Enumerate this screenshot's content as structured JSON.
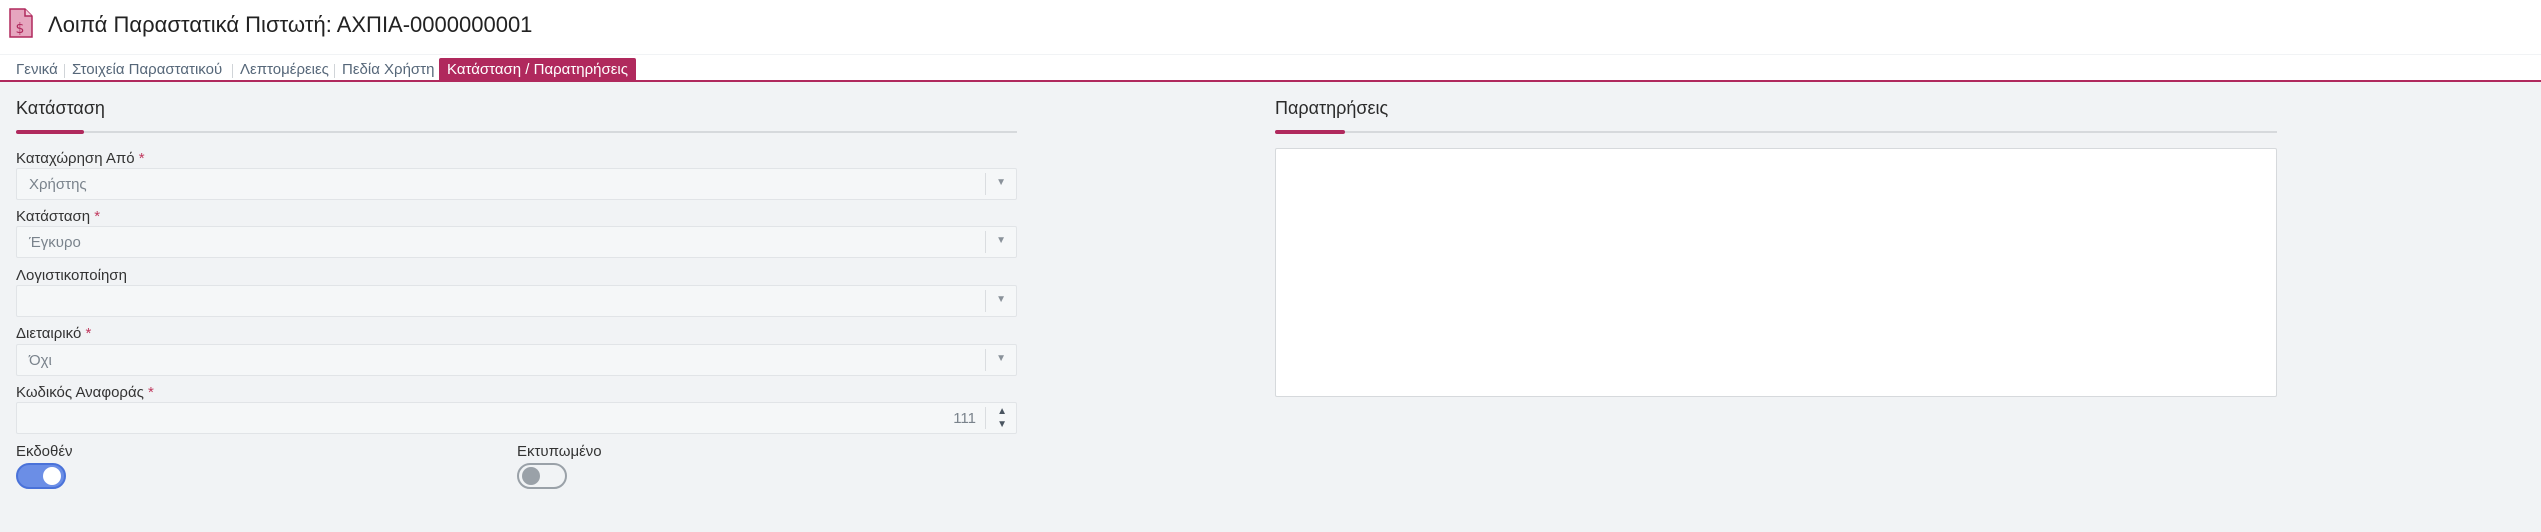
{
  "header": {
    "title": "Λοιπά Παραστατικά Πιστωτή: ΑΧΠΙΑ-0000000001",
    "icon": "dollar-document-icon",
    "accent_color": "#b0295d"
  },
  "tabs": [
    {
      "label": "Γενικά",
      "active": false
    },
    {
      "label": "Στοιχεία Παραστατικού",
      "active": false
    },
    {
      "label": "Λεπτομέρειες",
      "active": false
    },
    {
      "label": "Πεδία Χρήστη",
      "active": false
    },
    {
      "label": "Κατάσταση / Παρατηρήσεις",
      "active": true
    }
  ],
  "status_section": {
    "title": "Κατάσταση",
    "fields": {
      "registered_by": {
        "label": "Καταχώρηση Από",
        "required": "*",
        "value": "Χρήστης"
      },
      "status": {
        "label": "Κατάσταση",
        "required": "*",
        "value": "Έγκυρο"
      },
      "accounting": {
        "label": "Λογιστικοποίηση",
        "value": ""
      },
      "inter_company": {
        "label": "Διεταιρικό",
        "required": "*",
        "value": "Όχι"
      },
      "reference_code": {
        "label": "Κωδικός Αναφοράς",
        "required": "*",
        "value": "111"
      }
    },
    "toggles": {
      "issued": {
        "label": "Εκδοθέν",
        "on": true
      },
      "printed": {
        "label": "Εκτυπωμένο",
        "on": false
      }
    }
  },
  "notes_section": {
    "title": "Παρατηρήσεις",
    "value": ""
  }
}
